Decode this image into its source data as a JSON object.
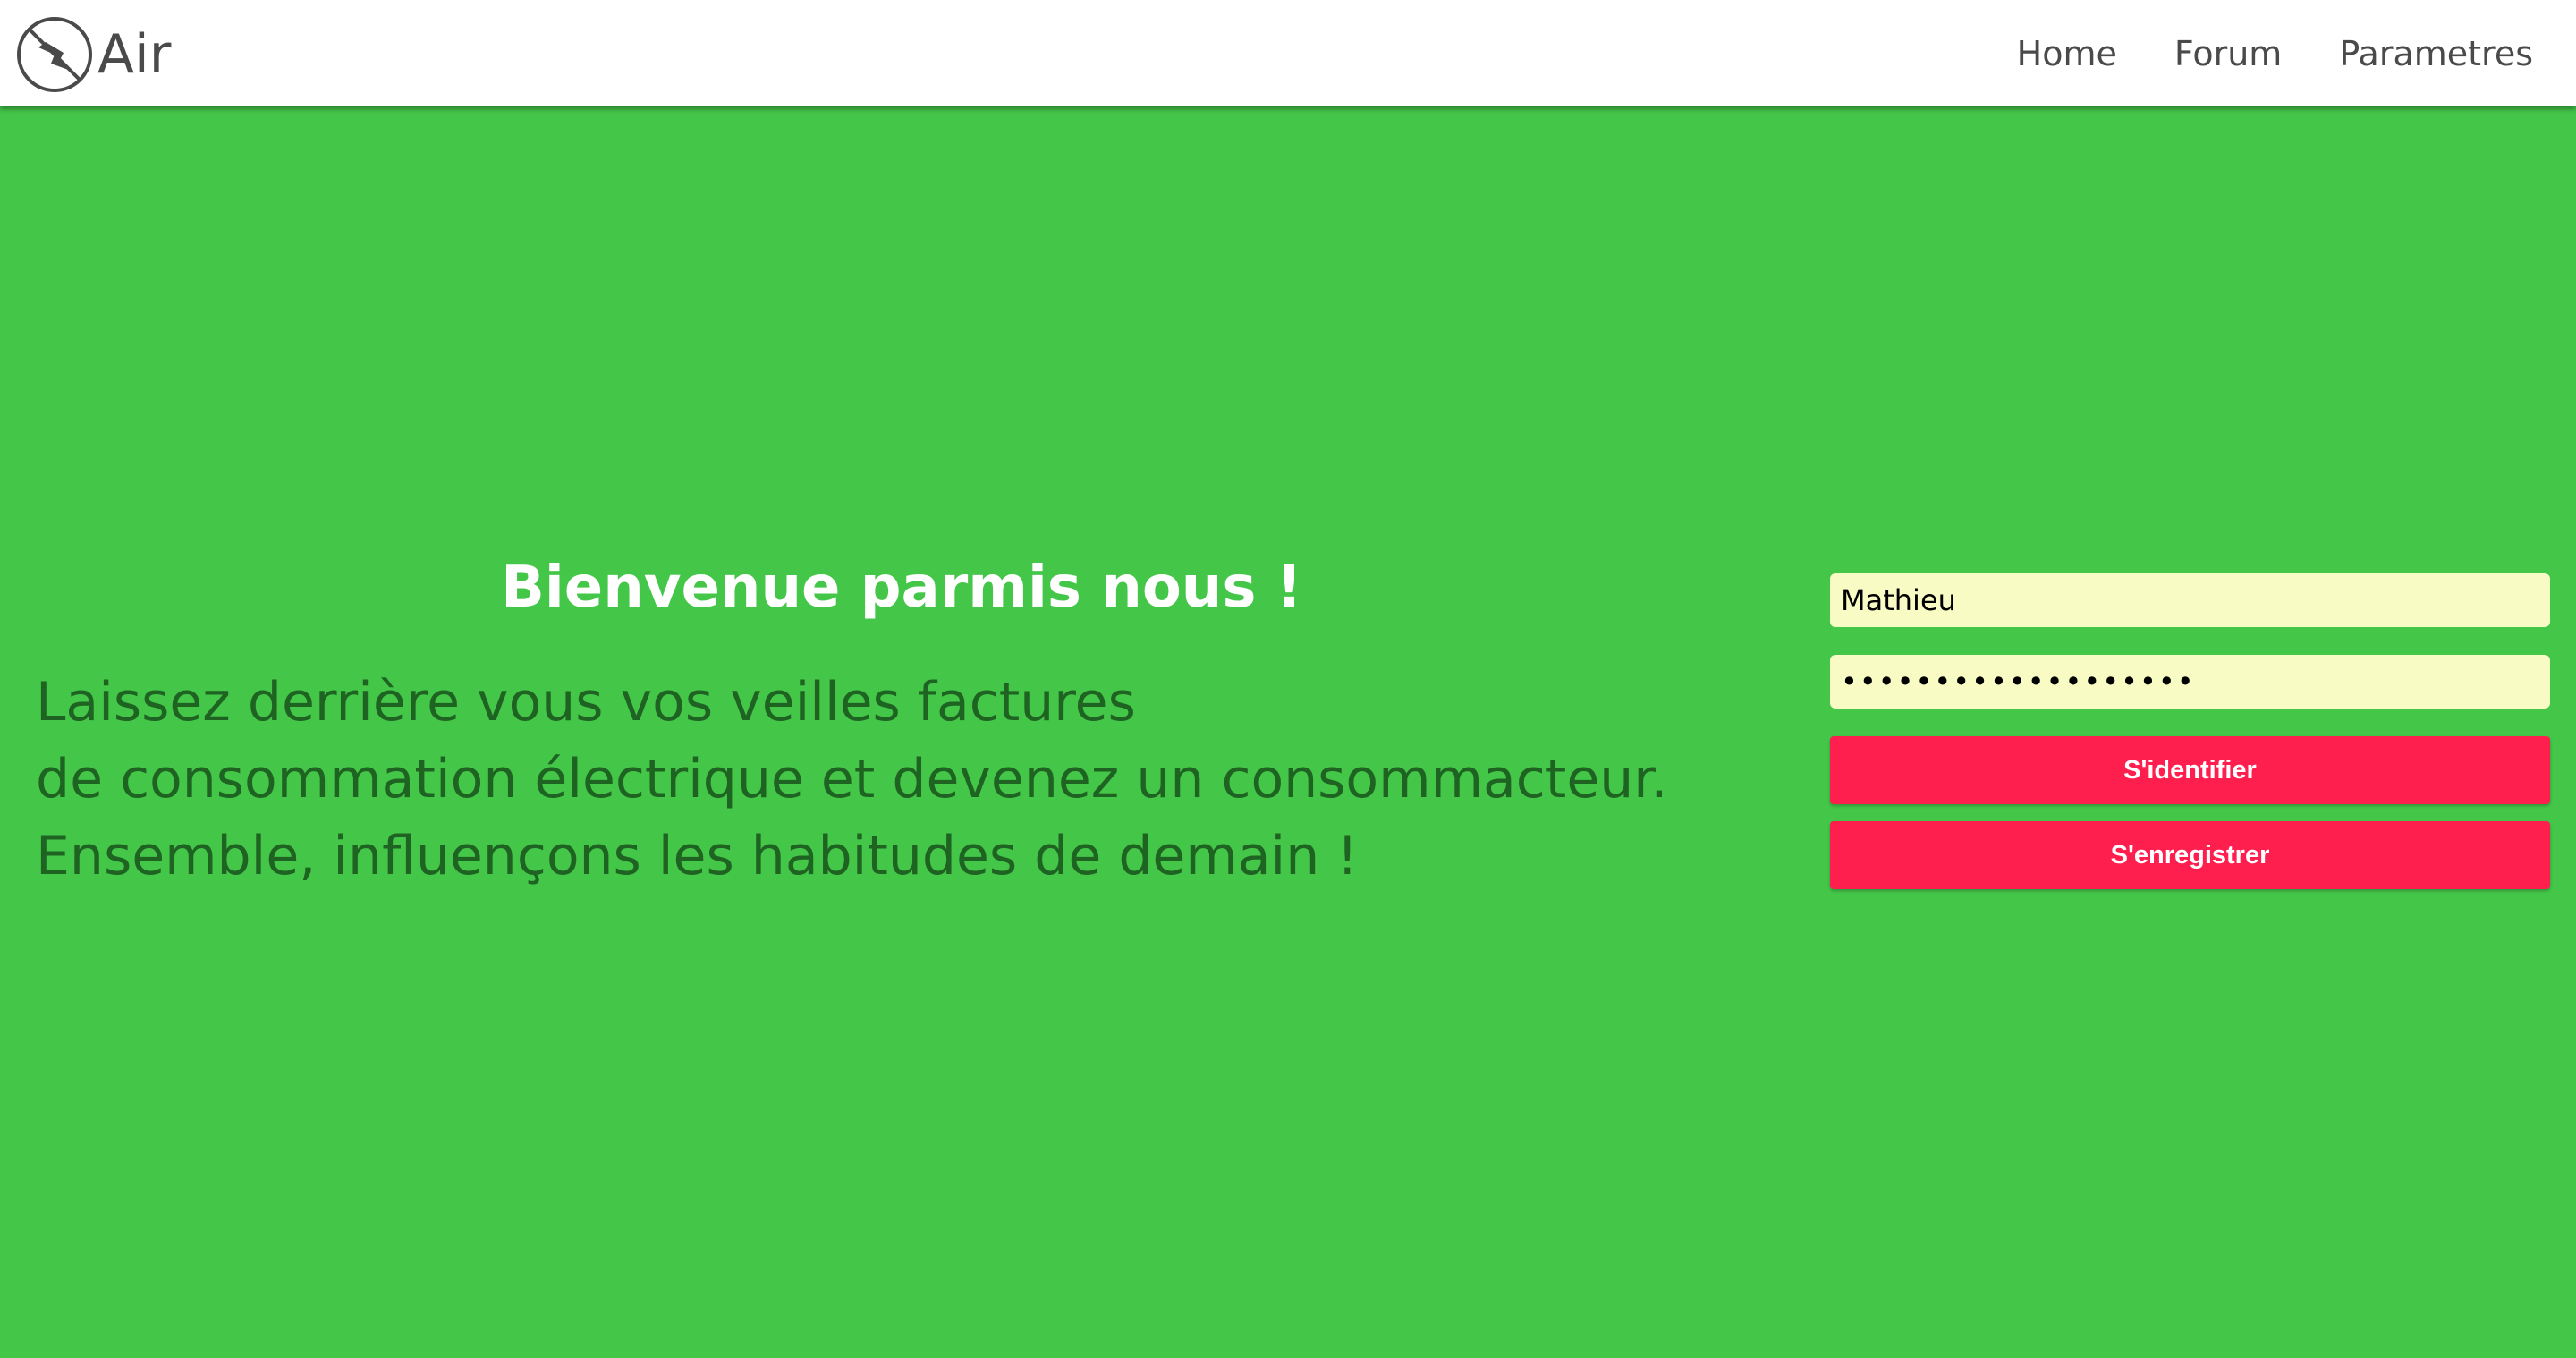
{
  "brand": {
    "name": "Air",
    "logo_icon": "lightning-bolt-circle-icon",
    "color": "#4a4a4a"
  },
  "nav": {
    "items": [
      {
        "label": "Home"
      },
      {
        "label": "Forum"
      },
      {
        "label": "Parametres"
      }
    ]
  },
  "hero": {
    "title": "Bienvenue parmis nous !",
    "lines": [
      "Laissez derrière vous vos veilles factures",
      "de consommation électrique et devenez un consommacteur.",
      "Ensemble, influençons les habitudes de demain !"
    ]
  },
  "login": {
    "username_value": "Mathieu",
    "password_value": "•••••••••••••••••••",
    "login_label": "S'identifier",
    "register_label": "S'enregistrer"
  },
  "colors": {
    "background": "#44c649",
    "navbar": "#ffffff",
    "input_bg": "#f8fbc4",
    "button": "#ff1f4f",
    "title_text": "#ffffff",
    "body_text": "#1e6321"
  }
}
